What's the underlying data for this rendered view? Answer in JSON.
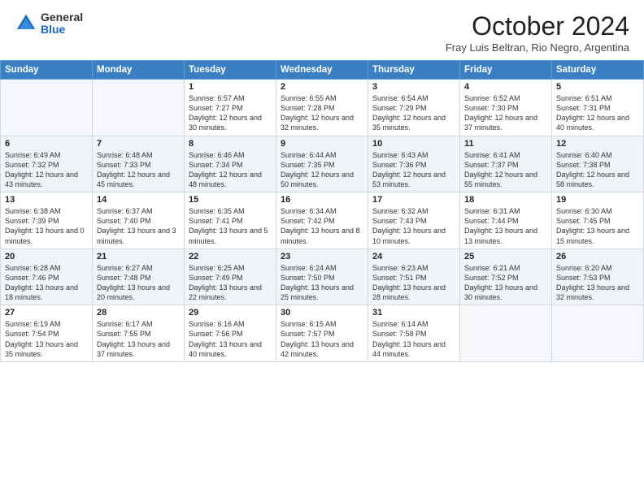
{
  "header": {
    "logo_general": "General",
    "logo_blue": "Blue",
    "month_title": "October 2024",
    "subtitle": "Fray Luis Beltran, Rio Negro, Argentina"
  },
  "days_of_week": [
    "Sunday",
    "Monday",
    "Tuesday",
    "Wednesday",
    "Thursday",
    "Friday",
    "Saturday"
  ],
  "weeks": [
    [
      {
        "day": "",
        "sunrise": "",
        "sunset": "",
        "daylight": ""
      },
      {
        "day": "",
        "sunrise": "",
        "sunset": "",
        "daylight": ""
      },
      {
        "day": "1",
        "sunrise": "Sunrise: 6:57 AM",
        "sunset": "Sunset: 7:27 PM",
        "daylight": "Daylight: 12 hours and 30 minutes."
      },
      {
        "day": "2",
        "sunrise": "Sunrise: 6:55 AM",
        "sunset": "Sunset: 7:28 PM",
        "daylight": "Daylight: 12 hours and 32 minutes."
      },
      {
        "day": "3",
        "sunrise": "Sunrise: 6:54 AM",
        "sunset": "Sunset: 7:29 PM",
        "daylight": "Daylight: 12 hours and 35 minutes."
      },
      {
        "day": "4",
        "sunrise": "Sunrise: 6:52 AM",
        "sunset": "Sunset: 7:30 PM",
        "daylight": "Daylight: 12 hours and 37 minutes."
      },
      {
        "day": "5",
        "sunrise": "Sunrise: 6:51 AM",
        "sunset": "Sunset: 7:31 PM",
        "daylight": "Daylight: 12 hours and 40 minutes."
      }
    ],
    [
      {
        "day": "6",
        "sunrise": "Sunrise: 6:49 AM",
        "sunset": "Sunset: 7:32 PM",
        "daylight": "Daylight: 12 hours and 43 minutes."
      },
      {
        "day": "7",
        "sunrise": "Sunrise: 6:48 AM",
        "sunset": "Sunset: 7:33 PM",
        "daylight": "Daylight: 12 hours and 45 minutes."
      },
      {
        "day": "8",
        "sunrise": "Sunrise: 6:46 AM",
        "sunset": "Sunset: 7:34 PM",
        "daylight": "Daylight: 12 hours and 48 minutes."
      },
      {
        "day": "9",
        "sunrise": "Sunrise: 6:44 AM",
        "sunset": "Sunset: 7:35 PM",
        "daylight": "Daylight: 12 hours and 50 minutes."
      },
      {
        "day": "10",
        "sunrise": "Sunrise: 6:43 AM",
        "sunset": "Sunset: 7:36 PM",
        "daylight": "Daylight: 12 hours and 53 minutes."
      },
      {
        "day": "11",
        "sunrise": "Sunrise: 6:41 AM",
        "sunset": "Sunset: 7:37 PM",
        "daylight": "Daylight: 12 hours and 55 minutes."
      },
      {
        "day": "12",
        "sunrise": "Sunrise: 6:40 AM",
        "sunset": "Sunset: 7:38 PM",
        "daylight": "Daylight: 12 hours and 58 minutes."
      }
    ],
    [
      {
        "day": "13",
        "sunrise": "Sunrise: 6:38 AM",
        "sunset": "Sunset: 7:39 PM",
        "daylight": "Daylight: 13 hours and 0 minutes."
      },
      {
        "day": "14",
        "sunrise": "Sunrise: 6:37 AM",
        "sunset": "Sunset: 7:40 PM",
        "daylight": "Daylight: 13 hours and 3 minutes."
      },
      {
        "day": "15",
        "sunrise": "Sunrise: 6:35 AM",
        "sunset": "Sunset: 7:41 PM",
        "daylight": "Daylight: 13 hours and 5 minutes."
      },
      {
        "day": "16",
        "sunrise": "Sunrise: 6:34 AM",
        "sunset": "Sunset: 7:42 PM",
        "daylight": "Daylight: 13 hours and 8 minutes."
      },
      {
        "day": "17",
        "sunrise": "Sunrise: 6:32 AM",
        "sunset": "Sunset: 7:43 PM",
        "daylight": "Daylight: 13 hours and 10 minutes."
      },
      {
        "day": "18",
        "sunrise": "Sunrise: 6:31 AM",
        "sunset": "Sunset: 7:44 PM",
        "daylight": "Daylight: 13 hours and 13 minutes."
      },
      {
        "day": "19",
        "sunrise": "Sunrise: 6:30 AM",
        "sunset": "Sunset: 7:45 PM",
        "daylight": "Daylight: 13 hours and 15 minutes."
      }
    ],
    [
      {
        "day": "20",
        "sunrise": "Sunrise: 6:28 AM",
        "sunset": "Sunset: 7:46 PM",
        "daylight": "Daylight: 13 hours and 18 minutes."
      },
      {
        "day": "21",
        "sunrise": "Sunrise: 6:27 AM",
        "sunset": "Sunset: 7:48 PM",
        "daylight": "Daylight: 13 hours and 20 minutes."
      },
      {
        "day": "22",
        "sunrise": "Sunrise: 6:25 AM",
        "sunset": "Sunset: 7:49 PM",
        "daylight": "Daylight: 13 hours and 22 minutes."
      },
      {
        "day": "23",
        "sunrise": "Sunrise: 6:24 AM",
        "sunset": "Sunset: 7:50 PM",
        "daylight": "Daylight: 13 hours and 25 minutes."
      },
      {
        "day": "24",
        "sunrise": "Sunrise: 6:23 AM",
        "sunset": "Sunset: 7:51 PM",
        "daylight": "Daylight: 13 hours and 28 minutes."
      },
      {
        "day": "25",
        "sunrise": "Sunrise: 6:21 AM",
        "sunset": "Sunset: 7:52 PM",
        "daylight": "Daylight: 13 hours and 30 minutes."
      },
      {
        "day": "26",
        "sunrise": "Sunrise: 6:20 AM",
        "sunset": "Sunset: 7:53 PM",
        "daylight": "Daylight: 13 hours and 32 minutes."
      }
    ],
    [
      {
        "day": "27",
        "sunrise": "Sunrise: 6:19 AM",
        "sunset": "Sunset: 7:54 PM",
        "daylight": "Daylight: 13 hours and 35 minutes."
      },
      {
        "day": "28",
        "sunrise": "Sunrise: 6:17 AM",
        "sunset": "Sunset: 7:55 PM",
        "daylight": "Daylight: 13 hours and 37 minutes."
      },
      {
        "day": "29",
        "sunrise": "Sunrise: 6:16 AM",
        "sunset": "Sunset: 7:56 PM",
        "daylight": "Daylight: 13 hours and 40 minutes."
      },
      {
        "day": "30",
        "sunrise": "Sunrise: 6:15 AM",
        "sunset": "Sunset: 7:57 PM",
        "daylight": "Daylight: 13 hours and 42 minutes."
      },
      {
        "day": "31",
        "sunrise": "Sunrise: 6:14 AM",
        "sunset": "Sunset: 7:58 PM",
        "daylight": "Daylight: 13 hours and 44 minutes."
      },
      {
        "day": "",
        "sunrise": "",
        "sunset": "",
        "daylight": ""
      },
      {
        "day": "",
        "sunrise": "",
        "sunset": "",
        "daylight": ""
      }
    ]
  ]
}
